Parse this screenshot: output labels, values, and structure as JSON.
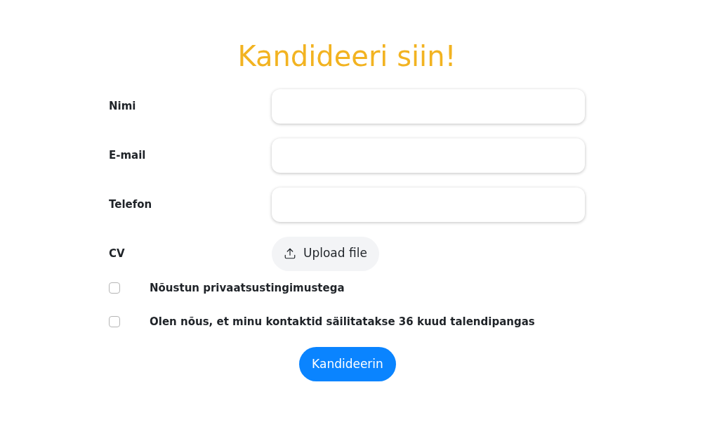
{
  "title": "Kandideeri siin!",
  "fields": [
    {
      "label": "Nimi",
      "kind": "text"
    },
    {
      "label": "E-mail",
      "kind": "text"
    },
    {
      "label": "Telefon",
      "kind": "text"
    },
    {
      "label": "CV",
      "kind": "file",
      "button": "Upload file"
    }
  ],
  "consents": [
    {
      "label": "Nõustun privaatsustingimustega",
      "checked": false
    },
    {
      "label": "Olen nõus, et minu kontaktid säilitatakse 36 kuud talendipangas",
      "checked": false
    }
  ],
  "submit": "Kandideerin"
}
